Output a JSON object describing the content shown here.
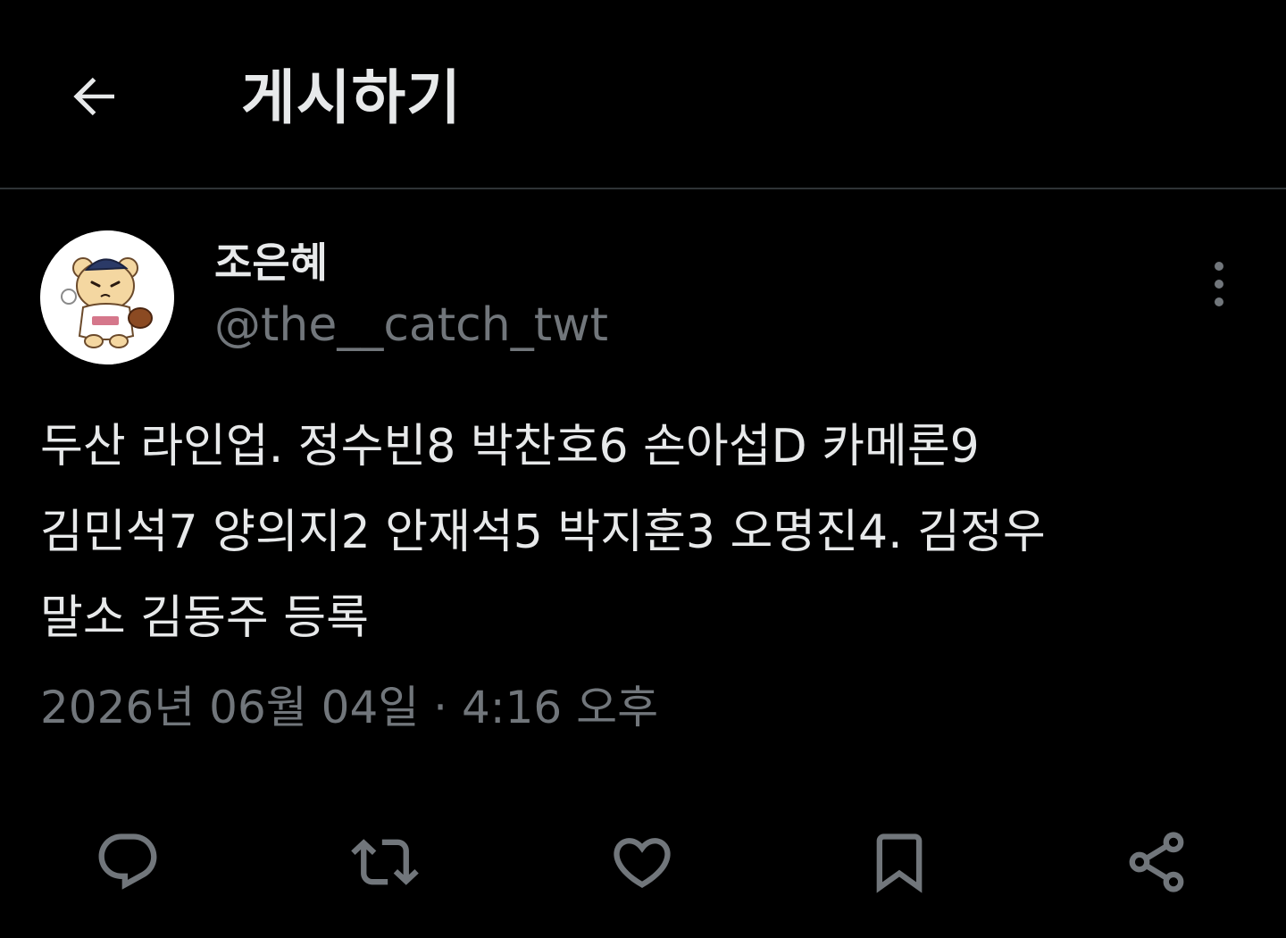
{
  "header": {
    "title": "게시하기",
    "back_icon": "arrow-left-icon"
  },
  "post": {
    "author": {
      "display_name": "조은혜",
      "handle": "@the__catch_twt",
      "avatar_icon": "bear-baseball-mascot-avatar"
    },
    "text": "두산 라인업. 정수빈8 박찬호6 손아섭D 카메론9\n김민석7 양의지2 안재석5 박지훈3 오명진4. 김정우\n말소 김동주 등록",
    "timestamp": "2026년 06월 04일 · 4:16 오후",
    "more_icon": "more-vertical-icon"
  },
  "actions": [
    {
      "name": "reply-button",
      "icon": "reply-icon"
    },
    {
      "name": "repost-button",
      "icon": "repost-icon"
    },
    {
      "name": "like-button",
      "icon": "heart-icon"
    },
    {
      "name": "bookmark-button",
      "icon": "bookmark-icon"
    },
    {
      "name": "share-button",
      "icon": "share-icon"
    }
  ],
  "colors": {
    "background": "#000000",
    "text_primary": "#e7e9ea",
    "text_secondary": "#71767b",
    "divider": "#2f3336"
  }
}
